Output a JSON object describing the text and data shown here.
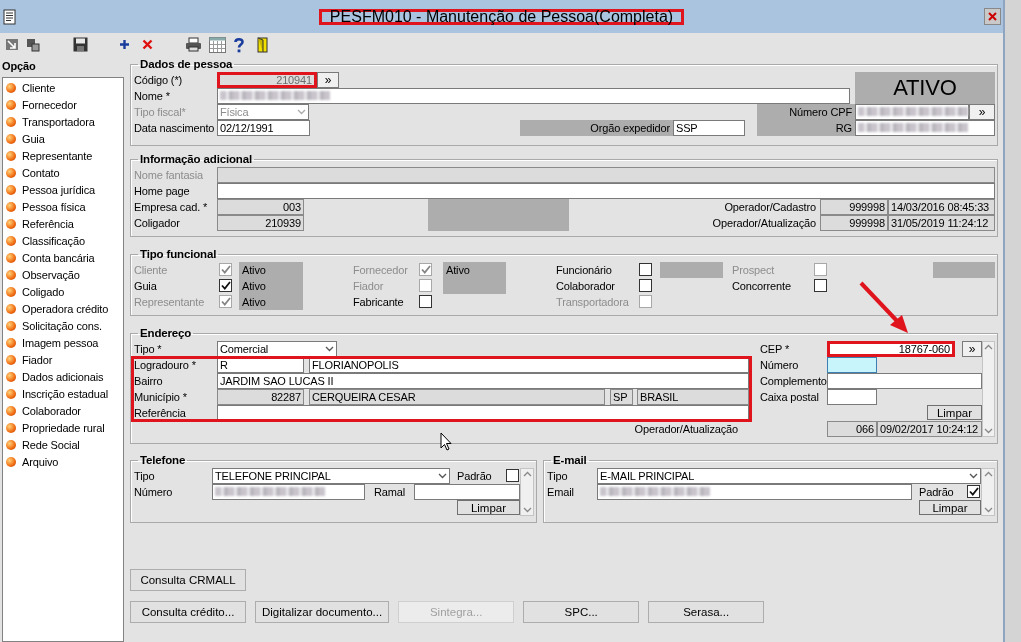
{
  "window": {
    "title": "PESFM010 - Manutenção de Pessoa(Completa)",
    "title_highlighted": true
  },
  "sidebar": {
    "title": "Opção",
    "items": [
      "Cliente",
      "Fornecedor",
      "Transportadora",
      "Guia",
      "Representante",
      "Contato",
      "Pessoa jurídica",
      "Pessoa física",
      "Referência",
      "Classificação",
      "Conta bancária",
      "Observação",
      "Coligado",
      "Operadora crédito",
      "Solicitação cons.",
      "Imagem pessoa",
      "Fiador",
      "Dados adicionais",
      "Inscrição estadual",
      "Colaborador",
      "Propriedade rural",
      "Rede Social",
      "Arquivo"
    ]
  },
  "dados_pessoa": {
    "title": "Dados de pessoa",
    "codigo": {
      "label": "Código (*)",
      "value": "210941",
      "button": "»",
      "highlighted": true
    },
    "nome": {
      "label": "Nome *",
      "redacted": true
    },
    "tipo_fiscal": {
      "label": "Tipo fiscal*",
      "value": "Física",
      "disabled": true
    },
    "data_nascimento": {
      "label": "Data nascimento",
      "value": "02/12/1991"
    },
    "situacao": "ATIVO",
    "numero_cpf": {
      "label": "Número CPF",
      "redacted": true,
      "button": "»"
    },
    "orgao_expedidor": {
      "label": "Orgão expedidor",
      "value": "SSP"
    },
    "rg": {
      "label": "RG",
      "redacted": true
    }
  },
  "informacao_adicional": {
    "title": "Informação adicional",
    "nome_fantasia": {
      "label": "Nome fantasia",
      "disabled": true
    },
    "home_page": {
      "label": "Home page"
    },
    "empresa_cad": {
      "label": "Empresa cad. *",
      "value": "003"
    },
    "coligador": {
      "label": "Coligador",
      "value": "210939"
    },
    "operador_cadastro": {
      "label": "Operador/Cadastro",
      "operator": "999998",
      "timestamp": "14/03/2016 08:45:33"
    },
    "operador_atualizacao": {
      "label": "Operador/Atualização",
      "operator": "999998",
      "timestamp": "31/05/2019 11:24:12"
    }
  },
  "tipo_funcional": {
    "title": "Tipo funcional",
    "groups": [
      {
        "items": [
          {
            "label": "Cliente",
            "checked": true,
            "disabled": true
          },
          {
            "label": "Guia",
            "checked": true,
            "disabled": false
          },
          {
            "label": "Representante",
            "checked": true,
            "disabled": true
          }
        ],
        "statuses": [
          "Ativo",
          "Ativo",
          "Ativo"
        ]
      },
      {
        "items": [
          {
            "label": "Fornecedor",
            "checked": true,
            "disabled": true
          },
          {
            "label": "Fiador",
            "checked": false,
            "disabled": true
          },
          {
            "label": "Fabricante",
            "checked": false,
            "disabled": false
          }
        ],
        "statuses": [
          "Ativo"
        ]
      },
      {
        "items": [
          {
            "label": "Funcionário",
            "checked": false,
            "disabled": false
          },
          {
            "label": "Colaborador",
            "checked": false,
            "disabled": false
          },
          {
            "label": "Transportadora",
            "checked": false,
            "disabled": true
          }
        ]
      },
      {
        "items": [
          {
            "label": "Prospect",
            "checked": false,
            "disabled": true
          },
          {
            "label": "Concorrente",
            "checked": false,
            "disabled": false
          }
        ]
      }
    ]
  },
  "endereco": {
    "title": "Endereço",
    "highlighted": true,
    "tipo": {
      "label": "Tipo *",
      "value": "Comercial"
    },
    "logradouro": {
      "label": "Logradouro *",
      "type": "R",
      "name": "FLORIANOPOLIS"
    },
    "bairro": {
      "label": "Bairro",
      "value": "JARDIM SAO LUCAS II"
    },
    "municipio": {
      "label": "Município *",
      "code": "82287",
      "name": "CERQUEIRA CESAR",
      "uf": "SP",
      "country": "BRASIL"
    },
    "referencia": {
      "label": "Referência"
    },
    "cep": {
      "label": "CEP *",
      "value": "18767-060",
      "button": "»",
      "highlighted": true
    },
    "numero": {
      "label": "Número",
      "focused": true
    },
    "complemento": {
      "label": "Complemento"
    },
    "caixa_postal": {
      "label": "Caixa postal"
    },
    "clear_button": "Limpar",
    "operador_atualizacao": {
      "label": "Operador/Atualização",
      "operator": "066",
      "timestamp": "09/02/2017 10:24:12"
    }
  },
  "telefone": {
    "title": "Telefone",
    "tipo": {
      "label": "Tipo",
      "value": "TELEFONE PRINCIPAL"
    },
    "padrao": {
      "label": "Padrão",
      "checked": false
    },
    "numero": {
      "label": "Número",
      "redacted": true
    },
    "ramal": {
      "label": "Ramal"
    },
    "clear_button": "Limpar"
  },
  "email": {
    "title": "E-mail",
    "tipo": {
      "label": "Tipo",
      "value": "E-MAIL PRINCIPAL"
    },
    "email": {
      "label": "Email",
      "redacted": true
    },
    "padrao": {
      "label": "Padrão",
      "checked": true
    },
    "clear_button": "Limpar"
  },
  "button_rows": [
    {
      "buttons": [
        {
          "label": "Consulta CRMALL",
          "disabled": false
        }
      ]
    },
    {
      "buttons": [
        {
          "label": "Consulta crédito...",
          "disabled": false
        },
        {
          "label": "Digitalizar documento...",
          "disabled": false
        },
        {
          "label": "Sintegra...",
          "disabled": true
        },
        {
          "label": "SPC...",
          "disabled": false
        },
        {
          "label": "Serasa...",
          "disabled": false
        }
      ]
    }
  ]
}
